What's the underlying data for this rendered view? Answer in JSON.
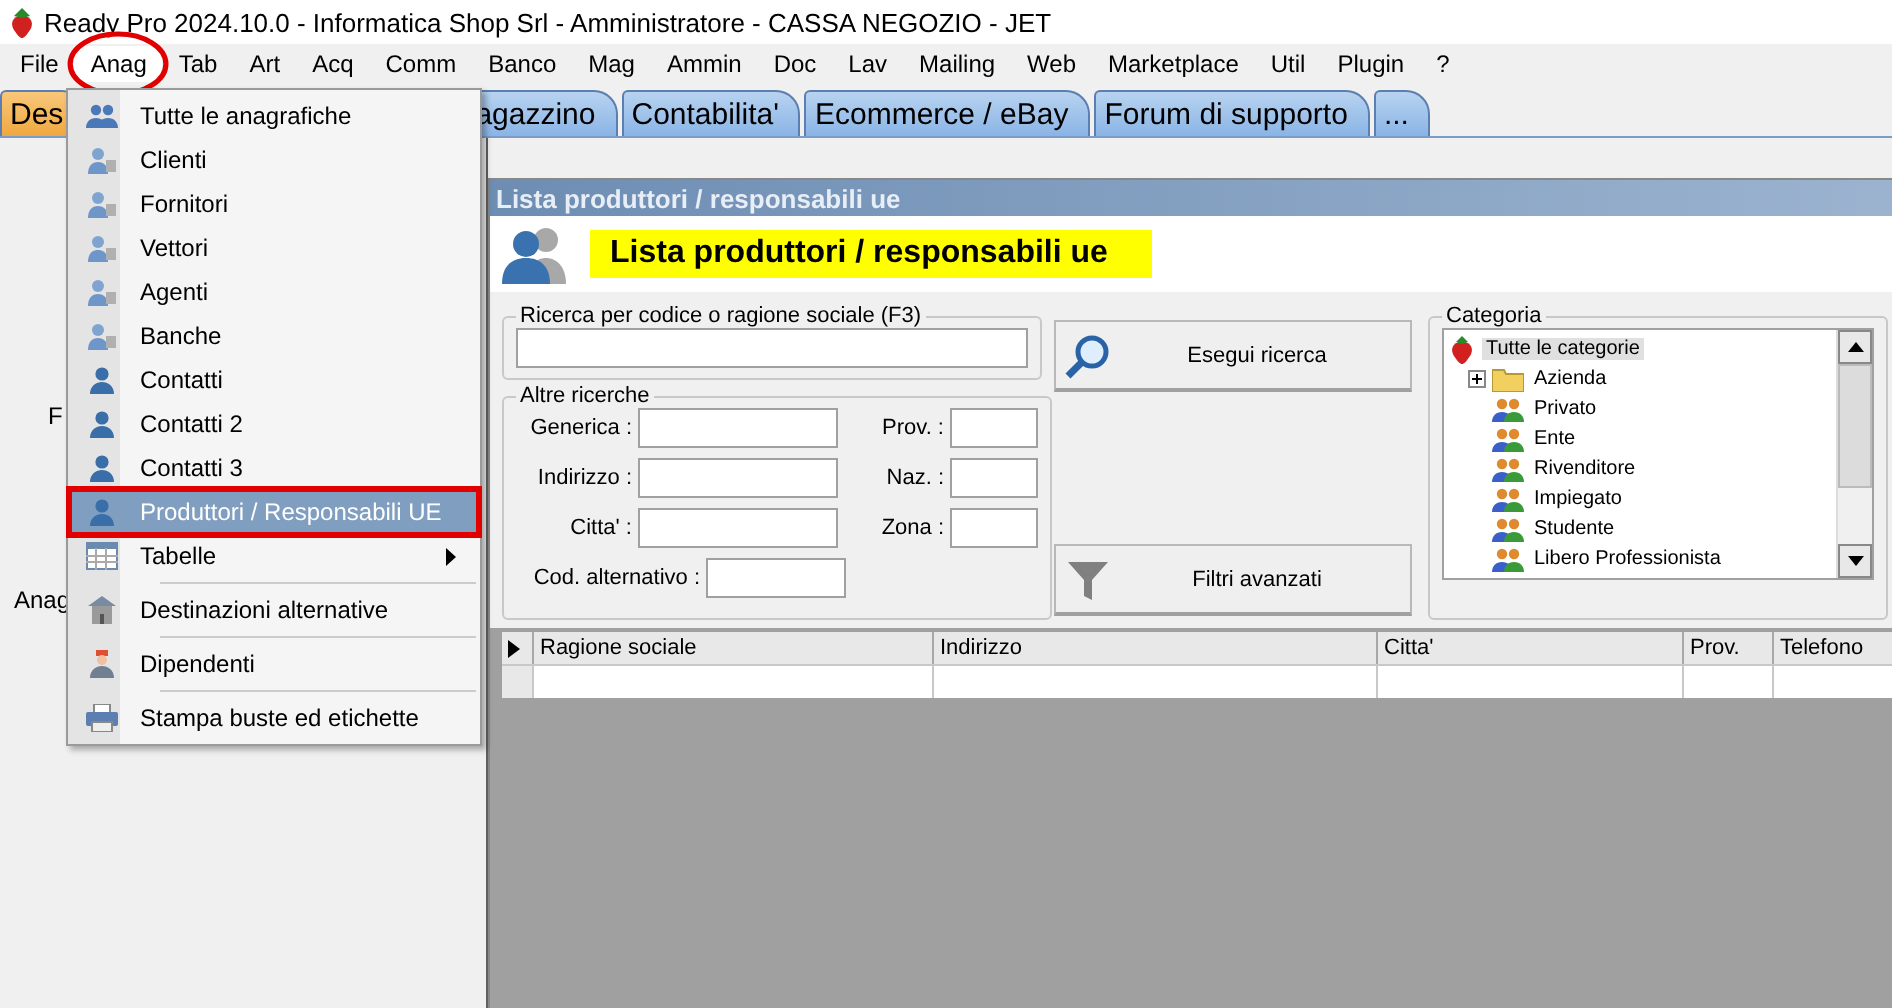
{
  "window": {
    "title": "Ready Pro 2024.10.0 - Informatica Shop Srl - Amministratore - CASSA NEGOZIO - JET"
  },
  "menubar": [
    {
      "label": "File",
      "selected": false
    },
    {
      "label": "Anag",
      "selected": true
    },
    {
      "label": "Tab",
      "selected": false
    },
    {
      "label": "Art",
      "selected": false
    },
    {
      "label": "Acq",
      "selected": false
    },
    {
      "label": "Comm",
      "selected": false
    },
    {
      "label": "Banco",
      "selected": false
    },
    {
      "label": "Mag",
      "selected": false
    },
    {
      "label": "Ammin",
      "selected": false
    },
    {
      "label": "Doc",
      "selected": false
    },
    {
      "label": "Lav",
      "selected": false
    },
    {
      "label": "Mailing",
      "selected": false
    },
    {
      "label": "Web",
      "selected": false
    },
    {
      "label": "Marketplace",
      "selected": false
    },
    {
      "label": "Util",
      "selected": false
    },
    {
      "label": "Plugin",
      "selected": false
    },
    {
      "label": "?",
      "selected": false
    }
  ],
  "tabs": [
    {
      "label": "Des",
      "selected": true
    },
    {
      "label": "agazzino",
      "selected": false
    },
    {
      "label": "Contabilita'",
      "selected": false
    },
    {
      "label": "Ecommerce / eBay",
      "selected": false
    },
    {
      "label": "Forum di supporto",
      "selected": false
    },
    {
      "label": "...",
      "selected": false
    }
  ],
  "background_texts": [
    "F",
    "Anag"
  ],
  "menu": [
    {
      "label": "Tutte le anagrafiche",
      "kind": "group",
      "selected": false,
      "separator_before": false
    },
    {
      "label": "Clienti",
      "kind": "person-card",
      "selected": false,
      "separator_before": false
    },
    {
      "label": "Fornitori",
      "kind": "person-card",
      "selected": false,
      "separator_before": false
    },
    {
      "label": "Vettori",
      "kind": "person-card",
      "selected": false,
      "separator_before": false
    },
    {
      "label": "Agenti",
      "kind": "person-card",
      "selected": false,
      "separator_before": false
    },
    {
      "label": "Banche",
      "kind": "person-card",
      "selected": false,
      "separator_before": false
    },
    {
      "label": "Contatti",
      "kind": "person",
      "selected": false,
      "separator_before": false
    },
    {
      "label": "Contatti 2",
      "kind": "person",
      "selected": false,
      "separator_before": false
    },
    {
      "label": "Contatti 3",
      "kind": "person",
      "selected": false,
      "separator_before": false
    },
    {
      "label": "Produttori / Responsabili UE",
      "kind": "person",
      "selected": true,
      "separator_before": false
    },
    {
      "label": "Tabelle",
      "kind": "submenu",
      "selected": false,
      "separator_before": false
    },
    {
      "label": "Destinazioni alternative",
      "kind": "building",
      "selected": false,
      "separator_before": true
    },
    {
      "label": "Dipendenti",
      "kind": "worker",
      "selected": false,
      "separator_before": true
    },
    {
      "label": "Stampa buste ed etichette",
      "kind": "printer",
      "selected": false,
      "separator_before": true
    }
  ],
  "child_window": {
    "title": "Lista produttori / responsabili ue",
    "heading": "Lista produttori / responsabili ue",
    "search_group": {
      "legend": "Ricerca per codice o ragione sociale (F3)"
    },
    "other_group": {
      "legend": "Altre ricerche",
      "rows": [
        [
          {
            "label": "Generica :"
          },
          {
            "label": "Prov. :"
          }
        ],
        [
          {
            "label": "Indirizzo :"
          },
          {
            "label": "Naz. :"
          }
        ],
        [
          {
            "label": "Citta' :"
          },
          {
            "label": "Zona :"
          }
        ],
        [
          {
            "label": "Cod. alternativo :"
          }
        ]
      ]
    },
    "buttons": [
      {
        "label": "Esegui ricerca",
        "kind": "search"
      },
      {
        "label": "Filtri avanzati",
        "kind": "filter"
      }
    ],
    "category_group": {
      "legend": "Categoria",
      "tree": [
        {
          "label": "Tutte le categorie",
          "selected": true,
          "kind": "root",
          "children": [
            {
              "label": "Azienda",
              "kind": "folder",
              "selected": false,
              "expanded": false
            },
            {
              "label": "Privato",
              "kind": "people",
              "selected": false
            },
            {
              "label": "Ente",
              "kind": "people",
              "selected": false
            },
            {
              "label": "Rivenditore",
              "kind": "people",
              "selected": false
            },
            {
              "label": "Impiegato",
              "kind": "people",
              "selected": false
            },
            {
              "label": "Studente",
              "kind": "people",
              "selected": false
            },
            {
              "label": "Libero Professionista",
              "kind": "people",
              "selected": false
            }
          ]
        }
      ]
    },
    "table": {
      "columns": [
        "Ragione sociale",
        "Indirizzo",
        "Citta'",
        "Prov.",
        "Telefono"
      ]
    }
  }
}
